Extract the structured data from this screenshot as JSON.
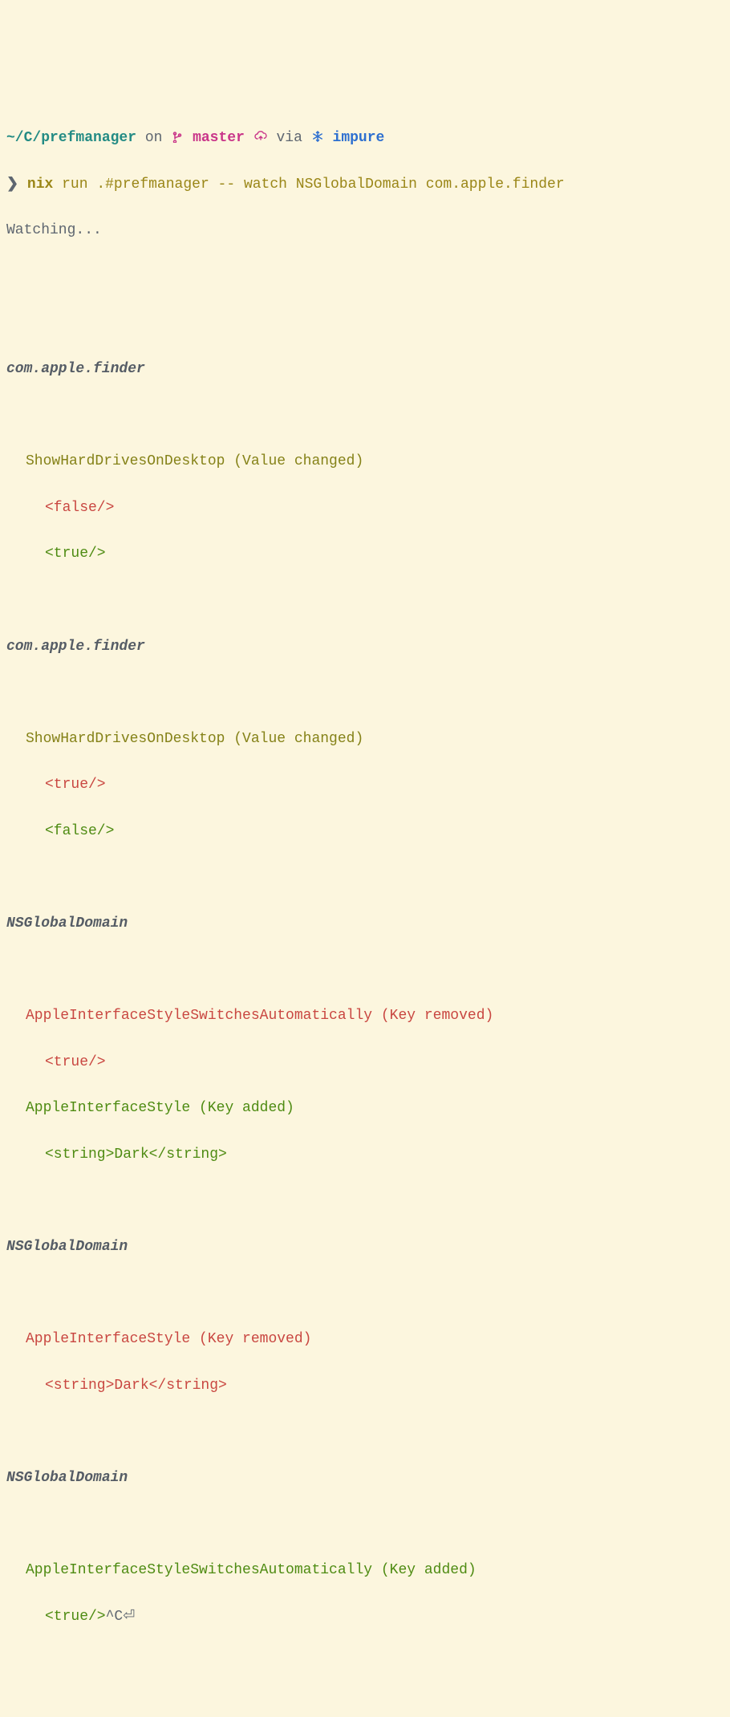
{
  "prompt": {
    "path": "~/C/prefmanager",
    "on": " on ",
    "branch": "master",
    "via": " via ",
    "env": "impure",
    "symbol": "❯",
    "command": "nix",
    "args": " run .#prefmanager -- watch NSGlobalDomain com.apple.finder"
  },
  "watching": "Watching...",
  "sections": [
    {
      "domain": "com.apple.finder",
      "entries": [
        {
          "key": "ShowHardDrivesOnDesktop (Value changed)",
          "removed": "<false/>",
          "added": "<true/>"
        }
      ]
    },
    {
      "domain": "com.apple.finder",
      "entries": [
        {
          "key": "ShowHardDrivesOnDesktop (Value changed)",
          "removed": "<true/>",
          "added": "<false/>"
        }
      ]
    },
    {
      "domain": "NSGlobalDomain",
      "entries": [
        {
          "key": "AppleInterfaceStyleSwitchesAutomatically (Key removed)",
          "removed": "<true/>",
          "keyClass": "red"
        },
        {
          "key": "AppleInterfaceStyle (Key added)",
          "added": "<string>Dark</string>",
          "keyClass": "green"
        }
      ]
    },
    {
      "domain": "NSGlobalDomain",
      "entries": [
        {
          "key": "AppleInterfaceStyle (Key removed)",
          "removed": "<string>Dark</string>",
          "keyClass": "red"
        }
      ]
    },
    {
      "domain": "NSGlobalDomain",
      "entries": [
        {
          "key": "AppleInterfaceStyleSwitchesAutomatically (Key added)",
          "added_inline": "<true/>",
          "ctrlc": "^C",
          "return": "⏎",
          "keyClass": "green"
        }
      ]
    }
  ]
}
